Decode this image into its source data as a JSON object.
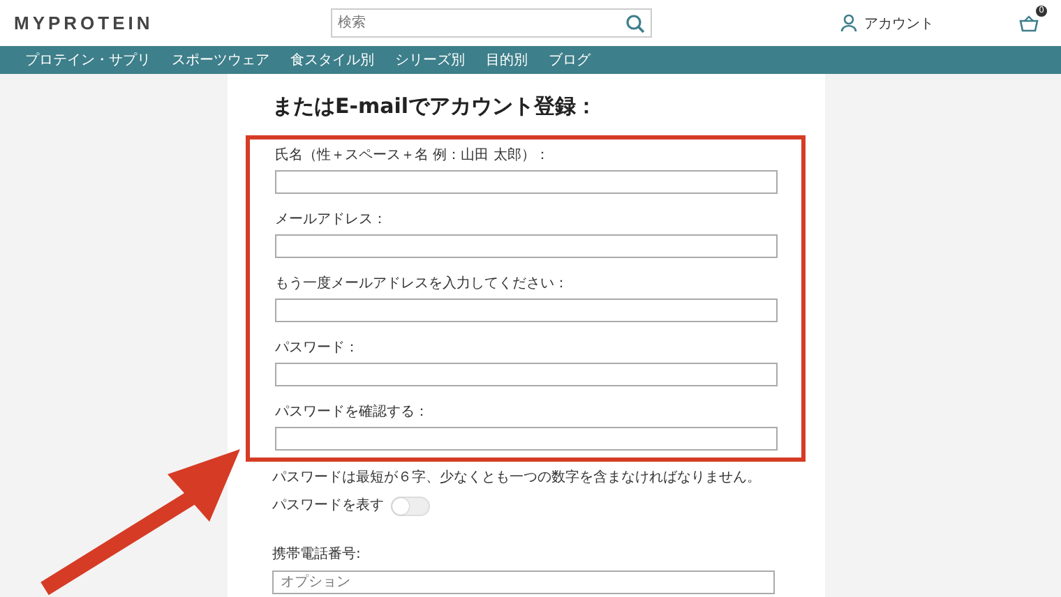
{
  "header": {
    "logo": "MYPROTEIN",
    "search": {
      "placeholder": "検索"
    },
    "account": "アカウント",
    "cart_count": "0"
  },
  "nav": [
    {
      "label": "プロテイン・サプリ"
    },
    {
      "label": "スポーツウェア"
    },
    {
      "label": "食スタイル別"
    },
    {
      "label": "シリーズ別"
    },
    {
      "label": "目的別"
    },
    {
      "label": "ブログ"
    }
  ],
  "form": {
    "title": "またはE-mailでアカウント登録：",
    "fields": [
      {
        "label": "氏名（性＋スペース＋名 例：山田 太郎）："
      },
      {
        "label": "メールアドレス："
      },
      {
        "label": "もう一度メールアドレスを入力してください："
      },
      {
        "label": "パスワード："
      },
      {
        "label": "パスワードを確認する："
      }
    ],
    "password_hint": "パスワードは最短が６字、少なくとも一つの数字を含まなければなりません。",
    "show_password": {
      "label": "パスワードを表す",
      "on": false
    },
    "phone": {
      "label": "携帯電話番号:",
      "placeholder": "オプション"
    }
  }
}
